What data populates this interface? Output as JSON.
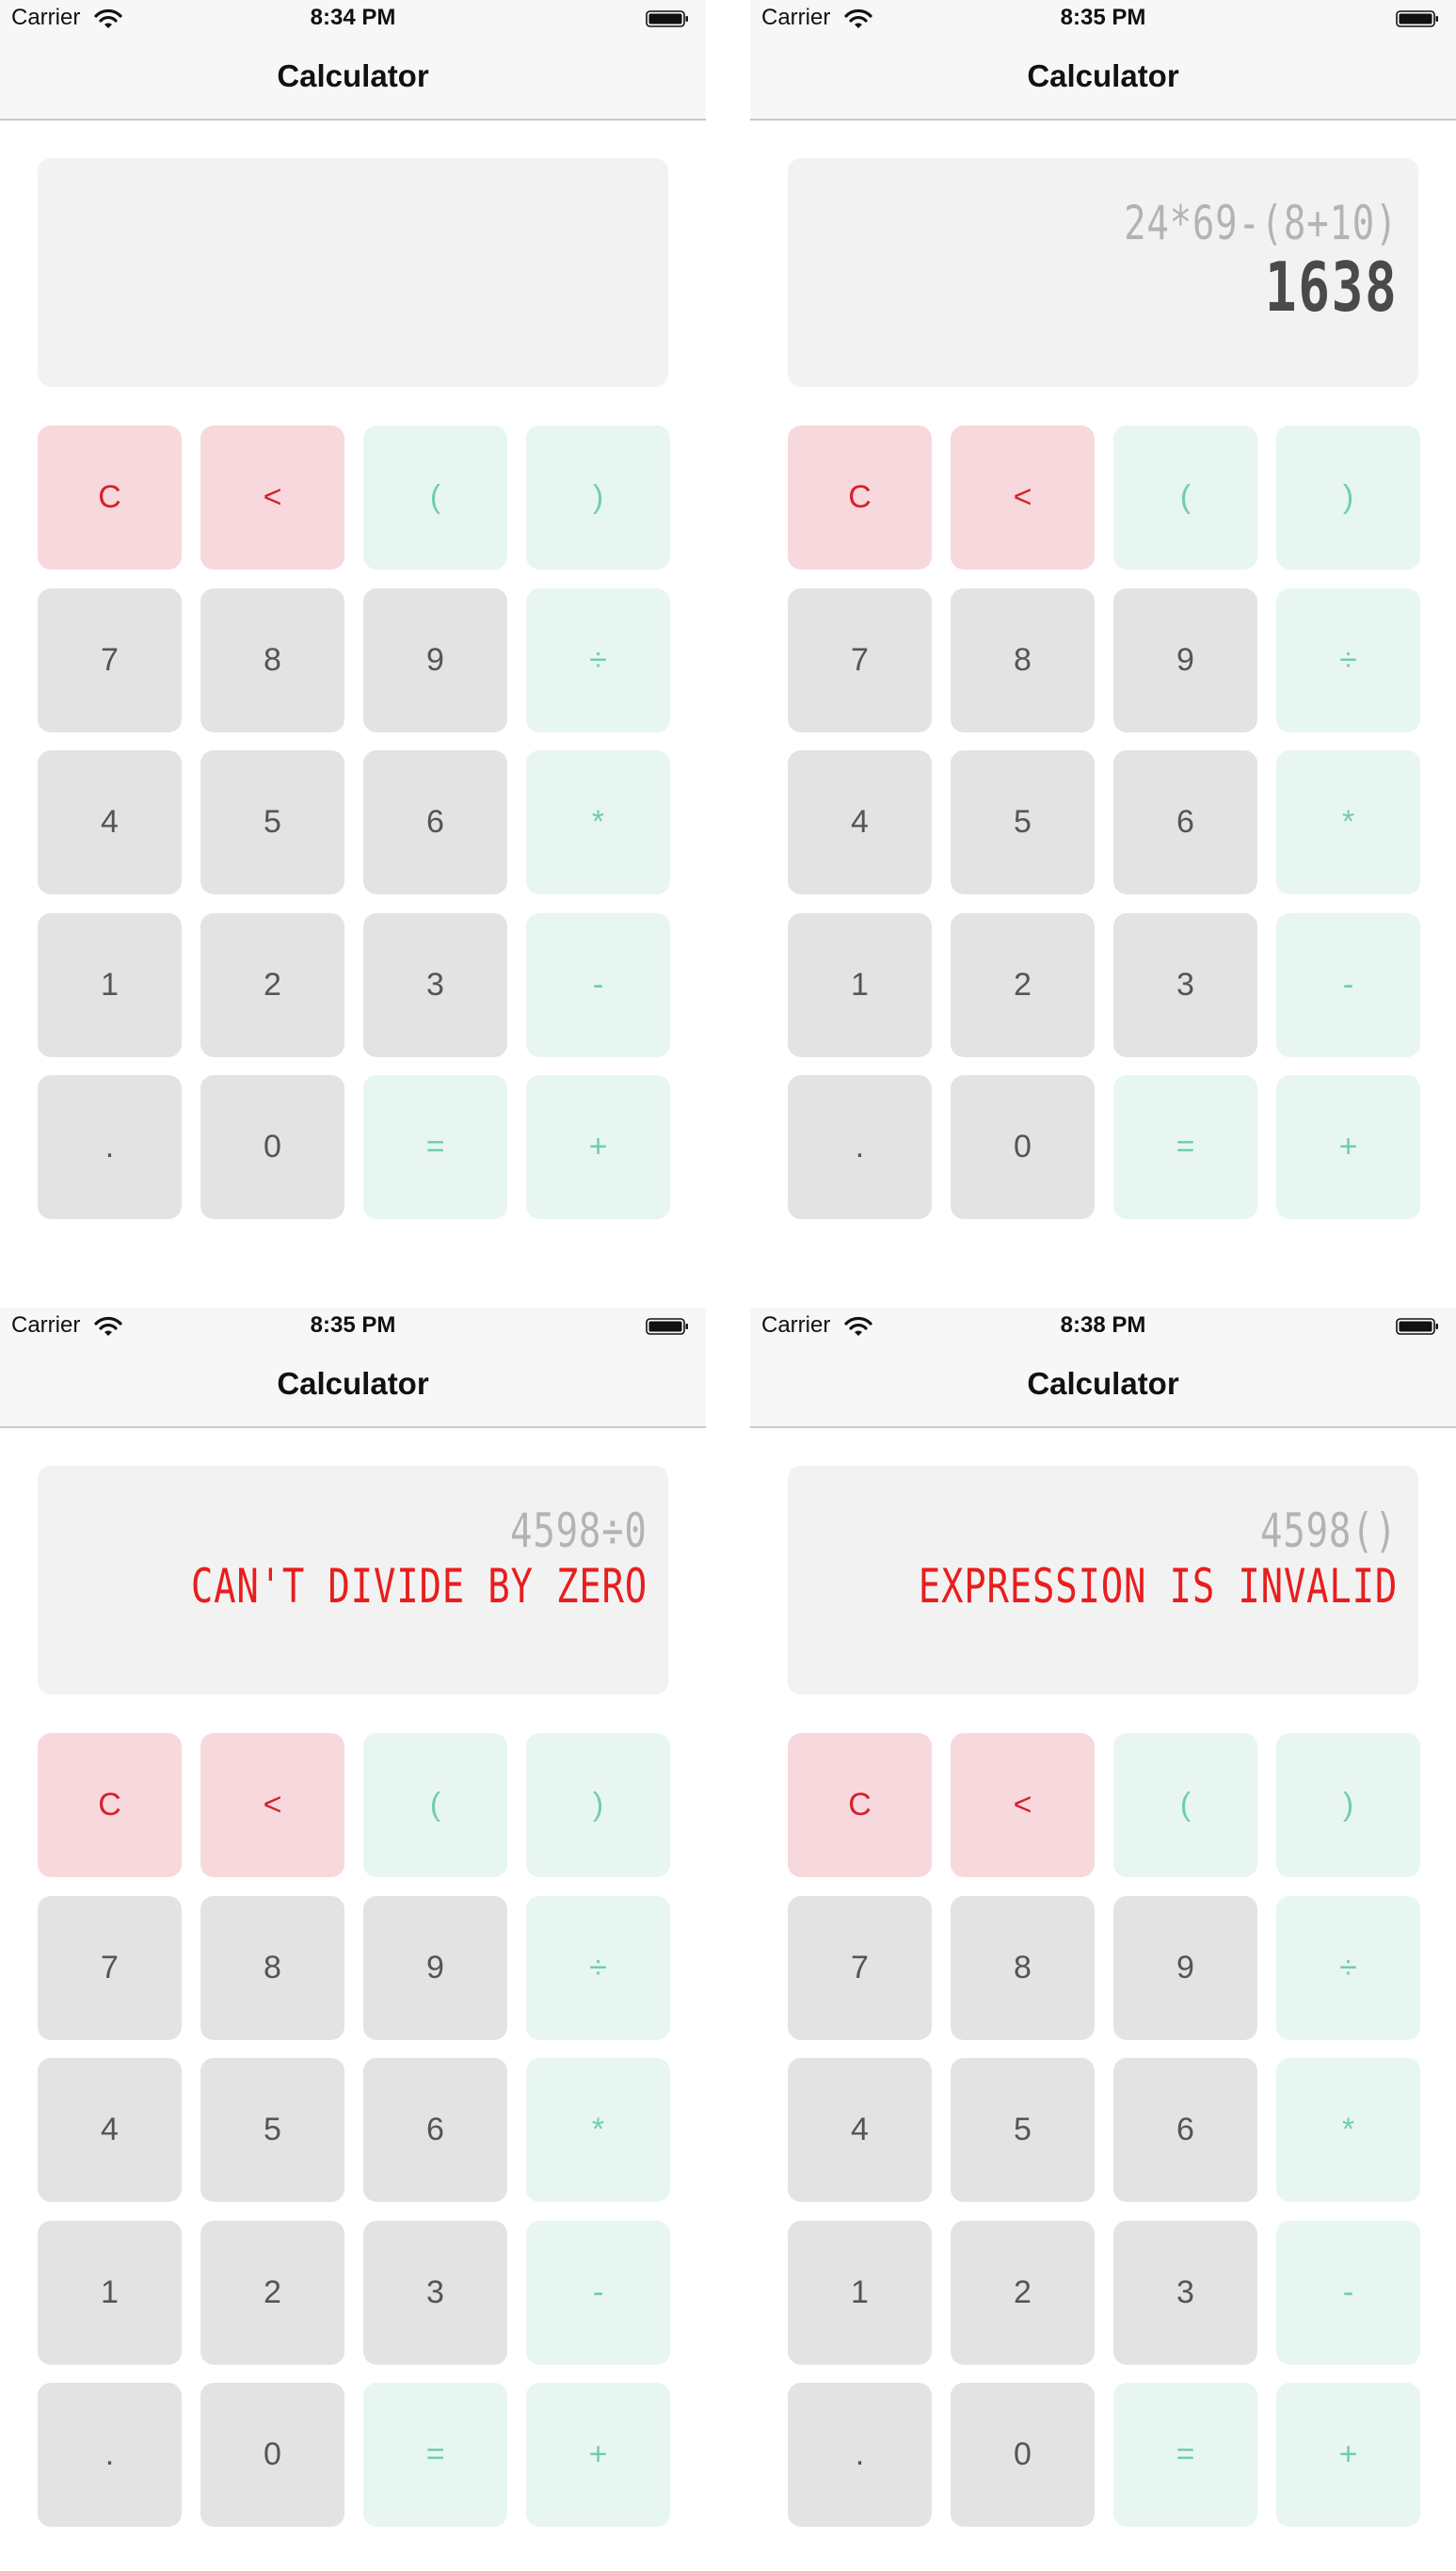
{
  "colors": {
    "clear_key_bg": "#f7d8dd",
    "clear_key_text": "#d6202b",
    "digit_key_bg": "#e3e3e3",
    "digit_key_text": "#555555",
    "operator_key_bg": "#e8f6f1",
    "operator_key_text": "#6fcfaa",
    "display_bg": "#f2f2f2",
    "expression_text": "#b3b3b3",
    "result_text": "#4a4a4a",
    "error_text": "#e81e1e"
  },
  "keypad": [
    {
      "label": "C",
      "role": "clear"
    },
    {
      "label": "<",
      "role": "backspace"
    },
    {
      "label": "(",
      "role": "operator"
    },
    {
      "label": ")",
      "role": "operator"
    },
    {
      "label": "7",
      "role": "digit"
    },
    {
      "label": "8",
      "role": "digit"
    },
    {
      "label": "9",
      "role": "digit"
    },
    {
      "label": "÷",
      "role": "operator"
    },
    {
      "label": "4",
      "role": "digit"
    },
    {
      "label": "5",
      "role": "digit"
    },
    {
      "label": "6",
      "role": "digit"
    },
    {
      "label": "*",
      "role": "operator"
    },
    {
      "label": "1",
      "role": "digit"
    },
    {
      "label": "2",
      "role": "digit"
    },
    {
      "label": "3",
      "role": "digit"
    },
    {
      "label": "-",
      "role": "operator"
    },
    {
      "label": ".",
      "role": "digit"
    },
    {
      "label": "0",
      "role": "digit"
    },
    {
      "label": "=",
      "role": "operator"
    },
    {
      "label": "+",
      "role": "operator"
    }
  ],
  "screens": [
    {
      "status": {
        "carrier": "Carrier",
        "time": "8:34 PM"
      },
      "title": "Calculator",
      "display": {
        "expression": "",
        "result": "",
        "is_error": false
      }
    },
    {
      "status": {
        "carrier": "Carrier",
        "time": "8:35 PM"
      },
      "title": "Calculator",
      "display": {
        "expression": "24*69-(8+10)",
        "result": "1638",
        "is_error": false
      }
    },
    {
      "status": {
        "carrier": "Carrier",
        "time": "8:35 PM"
      },
      "title": "Calculator",
      "display": {
        "expression": "4598÷0",
        "result": "CAN'T DIVIDE BY ZERO",
        "is_error": true
      }
    },
    {
      "status": {
        "carrier": "Carrier",
        "time": "8:38 PM"
      },
      "title": "Calculator",
      "display": {
        "expression": "4598()",
        "result": "EXPRESSION IS INVALID",
        "is_error": true
      }
    }
  ]
}
